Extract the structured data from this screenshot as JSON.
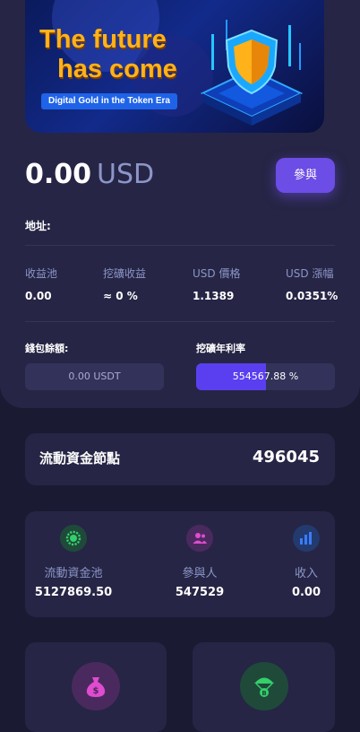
{
  "banner": {
    "title_line1": "The future",
    "title_line2": "has come",
    "subtitle": "Digital Gold in the Token Era"
  },
  "balance": {
    "amount": "0.00",
    "unit": "USD"
  },
  "join_button": "參與",
  "address_label": "地址:",
  "stats": {
    "labels": [
      "收益池",
      "挖礦收益",
      "USD 價格",
      "USD 漲幅"
    ],
    "values": [
      "0.00",
      "≈ 0 %",
      "1.1389",
      "0.0351%"
    ]
  },
  "wallet": {
    "label": "錢包餘額:",
    "value": "0.00 USDT"
  },
  "mining_rate": {
    "label": "挖礦年利率",
    "value": "554567.88 %",
    "fill_fraction": 0.5
  },
  "node_card": {
    "title": "流動資金節點",
    "count": "496045"
  },
  "pool_stats": [
    {
      "icon": "gear-coin-icon",
      "label": "流動資金池",
      "value": "5127869.50",
      "color": "#34d06a"
    },
    {
      "icon": "users-icon",
      "label": "參與人",
      "value": "547529",
      "color": "#e04bd0"
    },
    {
      "icon": "bar-chart-icon",
      "label": "收入",
      "value": "0.00",
      "color": "#3a7bff"
    }
  ],
  "bottom_icons": [
    {
      "icon": "money-bag-icon",
      "color": "#e04bd0"
    },
    {
      "icon": "parachute-coin-icon",
      "color": "#34d06a"
    }
  ]
}
